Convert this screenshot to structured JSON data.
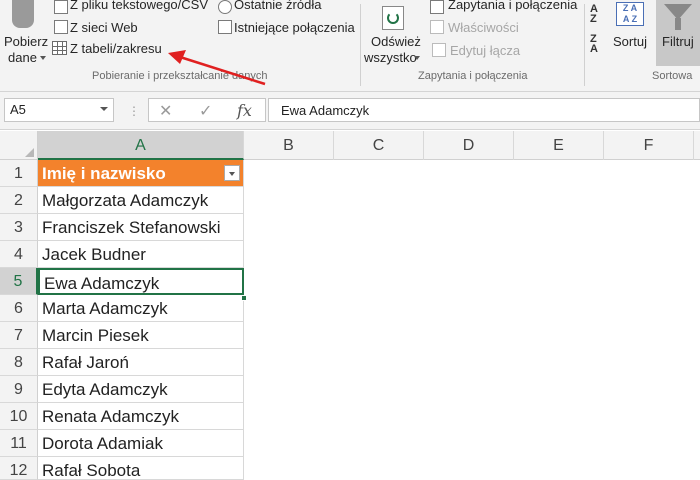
{
  "ribbon": {
    "get_data": {
      "label_line1": "Pobierz",
      "label_line2": "dane"
    },
    "from_text_csv": "Z pliku tekstowego/CSV",
    "from_web": "Z sieci Web",
    "from_table": "Z tabeli/zakresu",
    "recent_sources": "Ostatnie źródła",
    "existing_connections": "Istniejące połączenia",
    "group_get_transform": "Pobieranie i przekształcanie danych",
    "refresh_all": {
      "label_line1": "Odśwież",
      "label_line2": "wszystko"
    },
    "queries_connections": "Zapytania i połączenia",
    "properties": "Właściwości",
    "edit_links": "Edytuj łącza",
    "group_queries": "Zapytania i połączenia",
    "sort_az": "A Z",
    "sort_za": "Z A",
    "sort": "Sortuj",
    "filter": "Filtruj",
    "group_sort": "Sortowa",
    "accent_color": "#217346",
    "arrow_color": "#e02020"
  },
  "formula_bar": {
    "name_box": "A5",
    "cancel_icon": "✕",
    "enter_icon": "✓",
    "fx_label": "fx",
    "value": "Ewa Adamczyk"
  },
  "columns": [
    "A",
    "B",
    "C",
    "D",
    "E",
    "F"
  ],
  "rows": [
    {
      "num": "1",
      "value": "Imię i nazwisko"
    },
    {
      "num": "2",
      "value": "Małgorzata Adamczyk"
    },
    {
      "num": "3",
      "value": "Franciszek Stefanowski"
    },
    {
      "num": "4",
      "value": "Jacek Budner"
    },
    {
      "num": "5",
      "value": "Ewa Adamczyk"
    },
    {
      "num": "6",
      "value": "Marta Adamczyk"
    },
    {
      "num": "7",
      "value": "Marcin Piesek"
    },
    {
      "num": "8",
      "value": "Rafał Jaroń"
    },
    {
      "num": "9",
      "value": "Edyta Adamczyk"
    },
    {
      "num": "10",
      "value": "Renata Adamczyk"
    },
    {
      "num": "11",
      "value": "Dorota Adamiak"
    },
    {
      "num": "12",
      "value": "Rafał Sobota"
    }
  ],
  "table_header_color": "#f3822c"
}
